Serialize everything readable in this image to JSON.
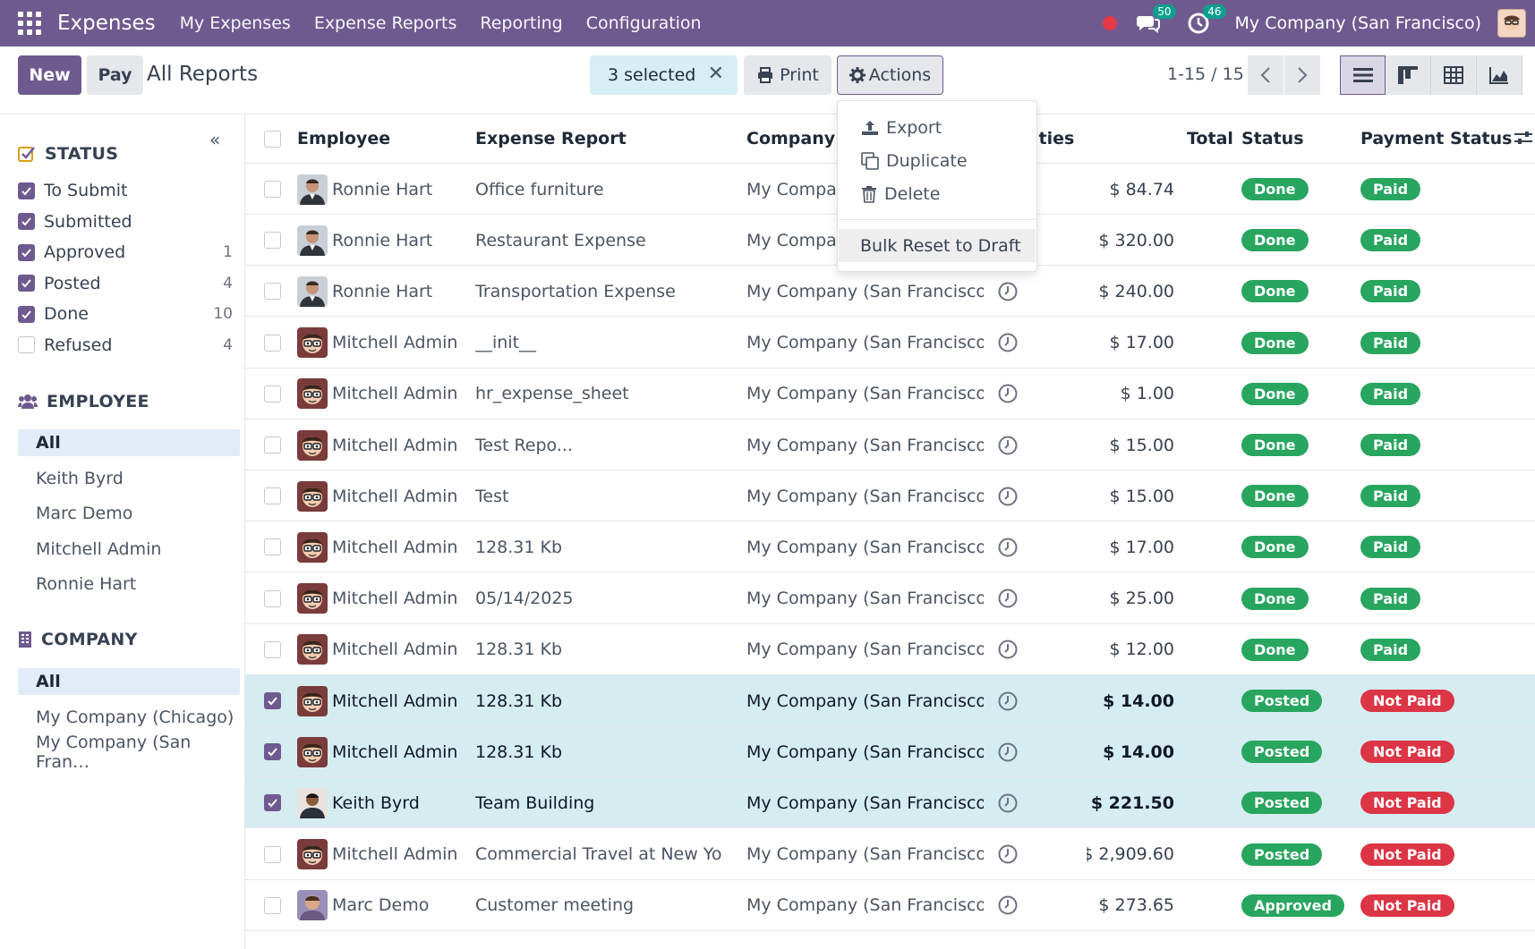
{
  "navbar": {
    "app_name": "Expenses",
    "menu": [
      "My Expenses",
      "Expense Reports",
      "Reporting",
      "Configuration"
    ],
    "messages_badge": "50",
    "activities_badge": "46",
    "company": "My Company (San Francisco)"
  },
  "control_panel": {
    "new_label": "New",
    "pay_label": "Pay",
    "title": "All Reports",
    "selected_label": "3 selected",
    "print_label": "Print",
    "actions_label": "Actions",
    "pager": "1-15 / 15"
  },
  "actions_menu": {
    "export": "Export",
    "duplicate": "Duplicate",
    "delete": "Delete",
    "bulk_reset": "Bulk Reset to Draft"
  },
  "sidebar": {
    "status_header": "STATUS",
    "status_items": [
      {
        "label": "To Submit",
        "count": "",
        "checked": true
      },
      {
        "label": "Submitted",
        "count": "",
        "checked": true
      },
      {
        "label": "Approved",
        "count": "1",
        "checked": true
      },
      {
        "label": "Posted",
        "count": "4",
        "checked": true
      },
      {
        "label": "Done",
        "count": "10",
        "checked": true
      },
      {
        "label": "Refused",
        "count": "4",
        "checked": false
      }
    ],
    "employee_header": "EMPLOYEE",
    "employee_items": [
      "All",
      "Keith Byrd",
      "Marc Demo",
      "Mitchell Admin",
      "Ronnie Hart"
    ],
    "company_header": "COMPANY",
    "company_items": [
      "All",
      "My Company (Chicago)",
      "My Company (San Fran…"
    ]
  },
  "table": {
    "headers": {
      "employee": "Employee",
      "report": "Expense Report",
      "company": "Company",
      "activities": "ities",
      "total": "Total",
      "status": "Status",
      "payment": "Payment Status"
    },
    "rows": [
      {
        "employee": "Ronnie Hart",
        "report": "Office furniture",
        "company": "My Compar",
        "total": "$ 84.74",
        "status": "Done",
        "payment": "Paid",
        "selected": false,
        "avatar": "ronnie"
      },
      {
        "employee": "Ronnie Hart",
        "report": "Restaurant Expense",
        "company": "My Compar",
        "total": "$ 320.00",
        "status": "Done",
        "payment": "Paid",
        "selected": false,
        "avatar": "ronnie"
      },
      {
        "employee": "Ronnie Hart",
        "report": "Transportation Expense",
        "company": "My Company (San Francisco)",
        "total": "$ 240.00",
        "status": "Done",
        "payment": "Paid",
        "selected": false,
        "avatar": "ronnie"
      },
      {
        "employee": "Mitchell Admin",
        "report": "__init__",
        "company": "My Company (San Francisco)",
        "total": "$ 17.00",
        "status": "Done",
        "payment": "Paid",
        "selected": false,
        "avatar": "mitchell"
      },
      {
        "employee": "Mitchell Admin",
        "report": "hr_expense_sheet",
        "company": "My Company (San Francisco)",
        "total": "$ 1.00",
        "status": "Done",
        "payment": "Paid",
        "selected": false,
        "avatar": "mitchell"
      },
      {
        "employee": "Mitchell Admin",
        "report": "Test Repo...",
        "company": "My Company (San Francisco)",
        "total": "$ 15.00",
        "status": "Done",
        "payment": "Paid",
        "selected": false,
        "avatar": "mitchell"
      },
      {
        "employee": "Mitchell Admin",
        "report": "Test",
        "company": "My Company (San Francisco)",
        "total": "$ 15.00",
        "status": "Done",
        "payment": "Paid",
        "selected": false,
        "avatar": "mitchell"
      },
      {
        "employee": "Mitchell Admin",
        "report": "128.31 Kb",
        "company": "My Company (San Francisco)",
        "total": "$ 17.00",
        "status": "Done",
        "payment": "Paid",
        "selected": false,
        "avatar": "mitchell"
      },
      {
        "employee": "Mitchell Admin",
        "report": "05/14/2025",
        "company": "My Company (San Francisco)",
        "total": "$ 25.00",
        "status": "Done",
        "payment": "Paid",
        "selected": false,
        "avatar": "mitchell"
      },
      {
        "employee": "Mitchell Admin",
        "report": "128.31 Kb",
        "company": "My Company (San Francisco)",
        "total": "$ 12.00",
        "status": "Done",
        "payment": "Paid",
        "selected": false,
        "avatar": "mitchell"
      },
      {
        "employee": "Mitchell Admin",
        "report": "128.31 Kb",
        "company": "My Company (San Francisco)",
        "total": "$ 14.00",
        "status": "Posted",
        "payment": "Not Paid",
        "selected": true,
        "avatar": "mitchell"
      },
      {
        "employee": "Mitchell Admin",
        "report": "128.31 Kb",
        "company": "My Company (San Francisco)",
        "total": "$ 14.00",
        "status": "Posted",
        "payment": "Not Paid",
        "selected": true,
        "avatar": "mitchell"
      },
      {
        "employee": "Keith Byrd",
        "report": "Team Building",
        "company": "My Company (San Francisco)",
        "total": "$ 221.50",
        "status": "Posted",
        "payment": "Not Paid",
        "selected": true,
        "avatar": "keith"
      },
      {
        "employee": "Mitchell Admin",
        "report": "Commercial Travel at New York",
        "company": "My Company (San Francisco)",
        "total": "$ 2,909.60",
        "status": "Posted",
        "payment": "Not Paid",
        "selected": false,
        "avatar": "mitchell"
      },
      {
        "employee": "Marc Demo",
        "report": "Customer meeting",
        "company": "My Company (San Francisco)",
        "total": "$ 273.65",
        "status": "Approved",
        "payment": "Not Paid",
        "selected": false,
        "avatar": "marc"
      }
    ]
  },
  "colors": {
    "brand": "#6f5a8f",
    "selected_row": "#d5ecf1",
    "status_green": "#28a55f",
    "status_red": "#dc3545"
  }
}
